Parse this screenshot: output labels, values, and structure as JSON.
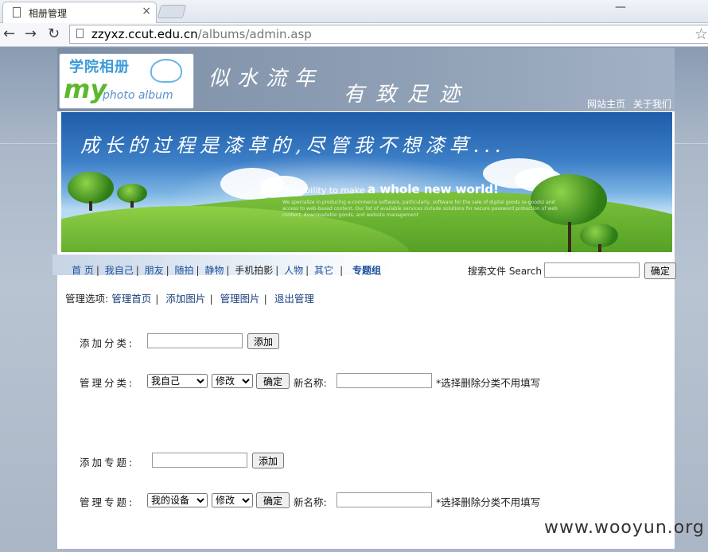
{
  "browser": {
    "tab_title": "相册管理",
    "tab_close": "×",
    "window_minimize": "—",
    "back_icon": "←",
    "forward_icon": "→",
    "reload_icon": "↻",
    "url_host": "zzyxz.ccut.edu.cn",
    "url_path": "/albums/admin.asp",
    "star_icon": "☆"
  },
  "header": {
    "logo_cn": "学院相册",
    "logo_my": "my",
    "logo_en": "photo album",
    "slogan1": "似水流年",
    "slogan2": "有致足迹",
    "top_links": [
      "网站主页",
      "关于我们"
    ]
  },
  "banner": {
    "caption": "成长的过程是漆草的,尽管我不想漆草...",
    "tagline_small": "the ability to make",
    "tagline_big": "a whole new world!",
    "fine_print": "We specialize in producing e-commerce software, particularly, software for the sale of digital goods (e-goods) and access to web-based content. Our list of available services include solutions for secure password protection of web content, downloadable goods, and website management"
  },
  "nav": {
    "items": [
      "首 页",
      "我自己",
      "朋友",
      "随拍",
      "静物",
      "手机拍影",
      "人物",
      "其它",
      "专题组"
    ]
  },
  "search": {
    "label": "搜索文件 Search",
    "value": "",
    "button": "确定"
  },
  "admin_menu": {
    "prefix": "管理选项:",
    "items": [
      "管理首页",
      "添加图片",
      "管理图片",
      "退出管理"
    ]
  },
  "forms": {
    "add_category": {
      "label": "添加分类:",
      "value": "",
      "button": "添加"
    },
    "manage_category": {
      "label": "管理分类:",
      "selected_category": "我自己",
      "action": "修改",
      "confirm": "确定",
      "new_name_label": "新名称:",
      "new_name_value": "",
      "note": "*选择删除分类不用填写"
    },
    "add_topic": {
      "label": "添加专题:",
      "value": "",
      "button": "添加"
    },
    "manage_topic": {
      "label": "管理专题:",
      "selected_topic": "我的设备",
      "action": "修改",
      "confirm": "确定",
      "new_name_label": "新名称:",
      "new_name_value": "",
      "note": "*选择删除分类不用填写"
    }
  },
  "watermark": "www.wooyun.org"
}
